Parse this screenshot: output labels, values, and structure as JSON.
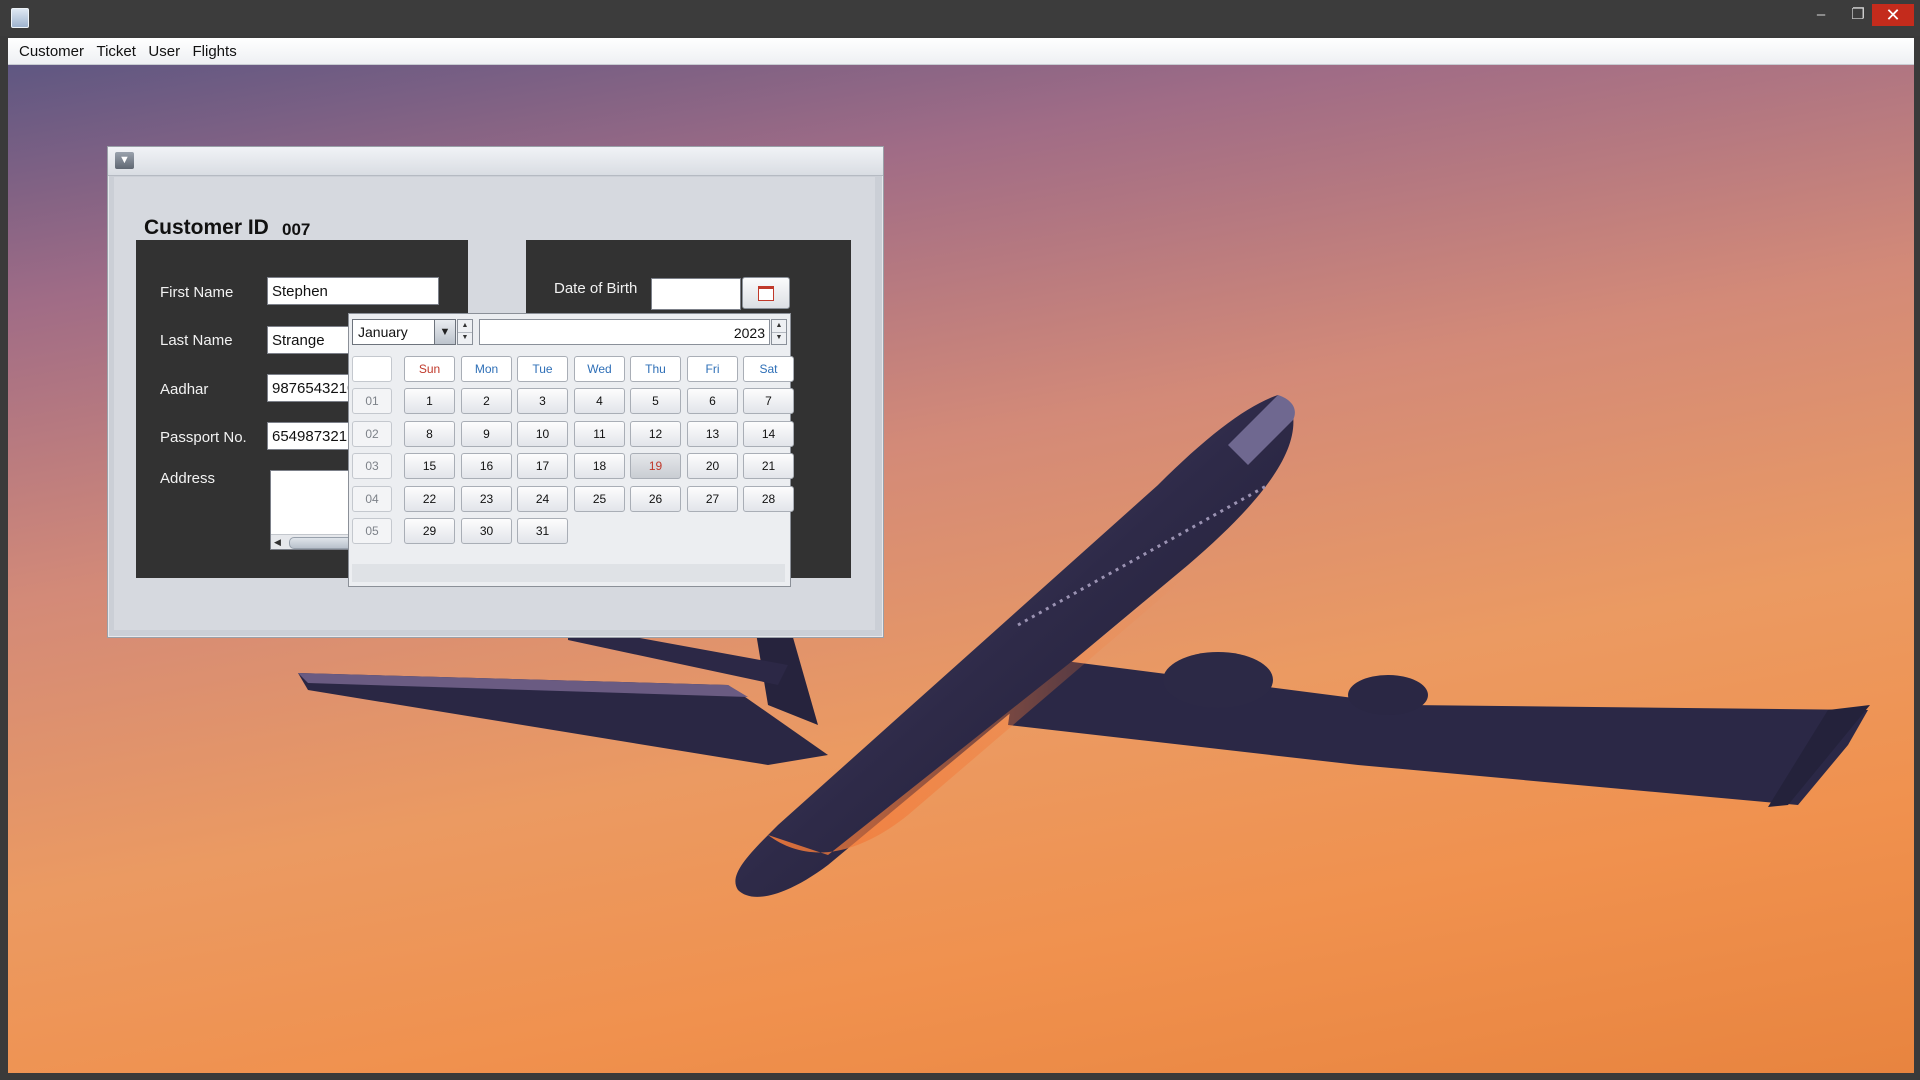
{
  "menubar": {
    "items": [
      "Customer",
      "Ticket",
      "User",
      "Flights"
    ]
  },
  "window_controls": {
    "minimize": "–",
    "maximize": "❐",
    "close": "✕"
  },
  "form": {
    "customer_id_label": "Customer ID",
    "customer_id_value": "007",
    "first_name_label": "First Name",
    "first_name_value": "Stephen",
    "last_name_label": "Last Name",
    "last_name_value": "Strange",
    "aadhar_label": "Aadhar",
    "aadhar_value": "9876543210",
    "passport_label": "Passport No.",
    "passport_value": "654987321",
    "address_label": "Address",
    "address_value": "",
    "dob_label": "Date of Birth",
    "dob_value": ""
  },
  "calendar": {
    "month": "January",
    "year": "2023",
    "weekdays": [
      "Sun",
      "Mon",
      "Tue",
      "Wed",
      "Thu",
      "Fri",
      "Sat"
    ],
    "weekday_colors": {
      "Sun": "#c0392b",
      "default": "#2e6fb7"
    },
    "today": "19",
    "today_color": "#c0392b",
    "weeks": [
      {
        "num": "01",
        "days": [
          "1",
          "2",
          "3",
          "4",
          "5",
          "6",
          "7"
        ]
      },
      {
        "num": "02",
        "days": [
          "8",
          "9",
          "10",
          "11",
          "12",
          "13",
          "14"
        ]
      },
      {
        "num": "03",
        "days": [
          "15",
          "16",
          "17",
          "18",
          "19",
          "20",
          "21"
        ]
      },
      {
        "num": "04",
        "days": [
          "22",
          "23",
          "24",
          "25",
          "26",
          "27",
          "28"
        ]
      },
      {
        "num": "05",
        "days": [
          "29",
          "30",
          "31"
        ]
      }
    ]
  },
  "icons": {
    "frame_menu": "chevron-down-icon",
    "date_button": "calendar-icon",
    "month_dropdown": "chevron-down-icon"
  }
}
